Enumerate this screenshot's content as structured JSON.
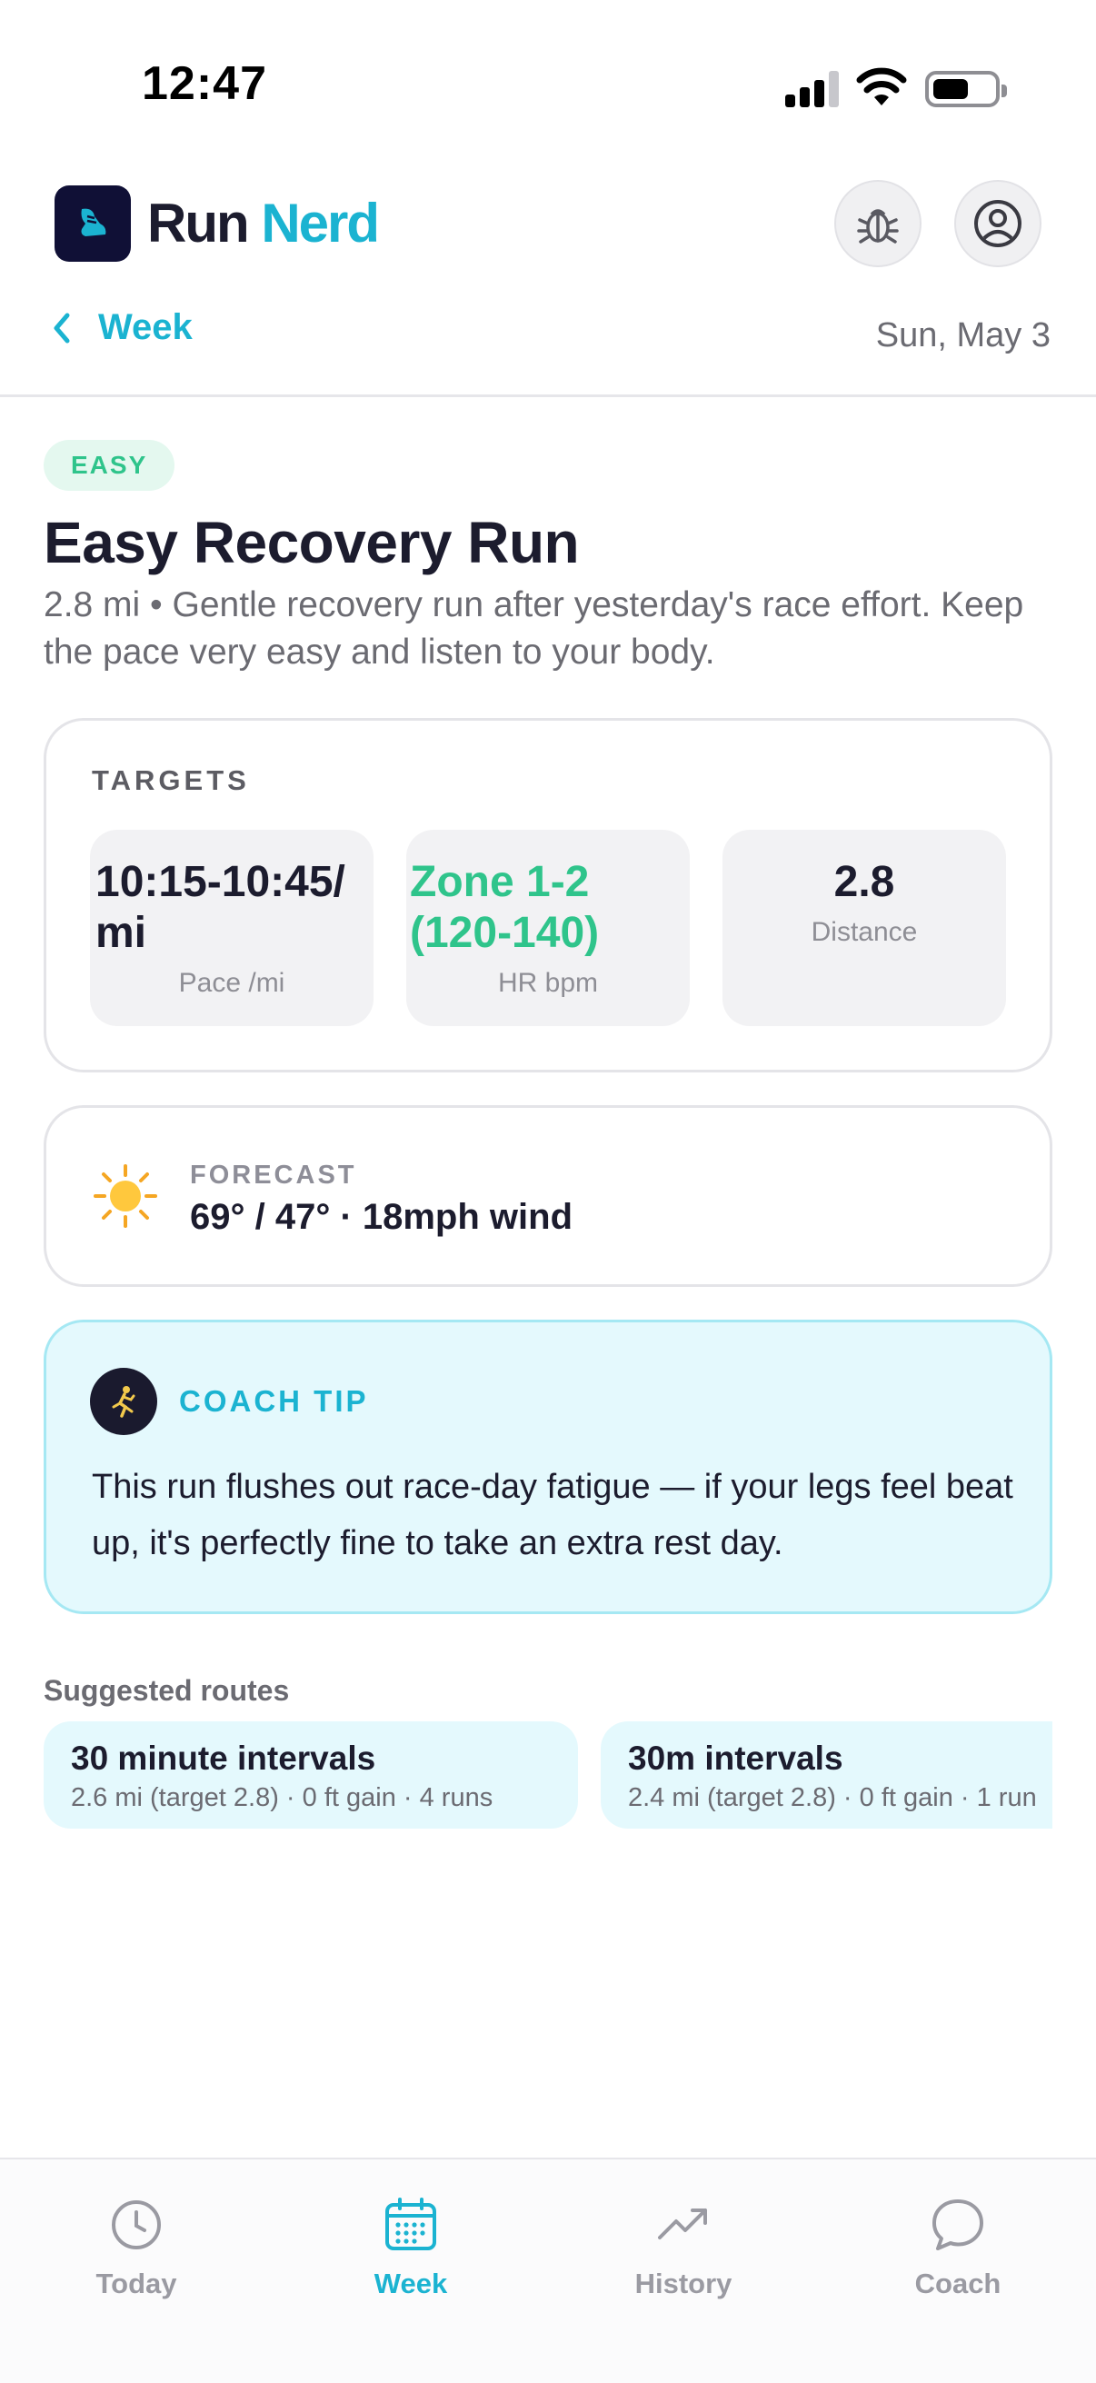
{
  "status_bar": {
    "time": "12:47"
  },
  "header": {
    "brand_part1": "Run",
    "brand_part2": "Nerd",
    "back_label": "Week",
    "date": "Sun, May 3"
  },
  "workout": {
    "badge": "EASY",
    "title": "Easy Recovery Run",
    "description": "2.8 mi • Gentle recovery run after yesterday's race effort. Keep the pace very easy and listen to your body."
  },
  "targets": {
    "label": "TARGETS",
    "pace_value": "10:15-10:45/ mi",
    "pace_caption": "Pace /mi",
    "hr_value": "Zone 1-2 (120-140)",
    "hr_caption": "HR bpm",
    "distance_value": "2.8",
    "distance_caption": "Distance"
  },
  "forecast": {
    "label": "FORECAST",
    "value": "69° / 47° · 18mph wind",
    "icon": "sun-icon"
  },
  "coach_tip": {
    "label": "COACH TIP",
    "text": "This run flushes out race-day fatigue — if your legs feel beat up, it's perfectly fine to take an extra rest day.",
    "icon": "runner-icon"
  },
  "routes": {
    "label": "Suggested routes",
    "items": [
      {
        "name": "30 minute intervals",
        "meta": "2.6 mi (target 2.8) · 0 ft gain · 4 runs"
      },
      {
        "name": "30m intervals",
        "meta": "2.4 mi (target 2.8) · 0 ft gain · 1 run"
      }
    ]
  },
  "tabs": [
    {
      "label": "Today",
      "icon": "clock-icon",
      "active": false
    },
    {
      "label": "Week",
      "icon": "calendar-icon",
      "active": true
    },
    {
      "label": "History",
      "icon": "trend-icon",
      "active": false
    },
    {
      "label": "Coach",
      "icon": "chat-bubble-icon",
      "active": false
    }
  ],
  "colors": {
    "accent": "#1bb3d1",
    "easy_green": "#2fc48b",
    "navy": "#101036",
    "tip_background": "#e4f9fd"
  }
}
